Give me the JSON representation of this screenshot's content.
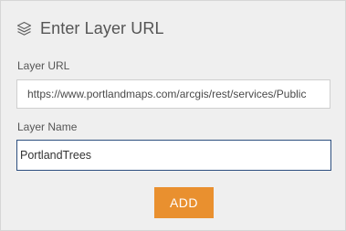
{
  "dialog": {
    "title": "Enter Layer URL",
    "title_icon": "layers-icon"
  },
  "layer_url": {
    "label": "Layer URL",
    "value": "https://www.portlandmaps.com/arcgis/rest/services/Public"
  },
  "layer_name": {
    "label": "Layer Name",
    "value": "PortlandTrees"
  },
  "add_button": {
    "label": "ADD"
  },
  "colors": {
    "panel_background": "#efefef",
    "button_accent": "#e9902f",
    "focused_border": "#2d4f7f",
    "text": "#555555"
  }
}
